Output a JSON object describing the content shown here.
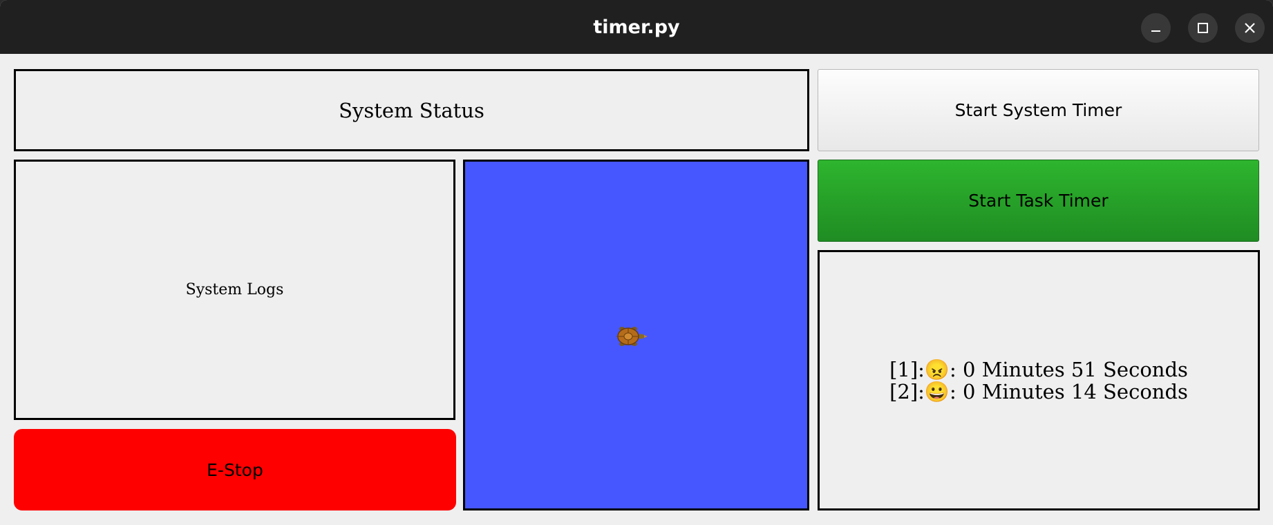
{
  "window": {
    "title": "timer.py",
    "controls": [
      "minimize-icon",
      "maximize-icon",
      "close-icon"
    ]
  },
  "panels": {
    "status_label": "System Status",
    "logs_label": "System Logs",
    "estop_label": "E-Stop",
    "system_timer_button": "Start System Timer",
    "task_timer_button": "Start Task Timer"
  },
  "task_log": {
    "lines": [
      "[1]:😠: 0 Minutes 51 Seconds",
      "[2]:😀: 0 Minutes 14 Seconds"
    ]
  },
  "canvas": {
    "background": "#4657ff",
    "sprite": "turtle-icon"
  },
  "colors": {
    "estop": "#ff0000",
    "task_button": "#2eb52e",
    "titlebar": "#202020"
  }
}
